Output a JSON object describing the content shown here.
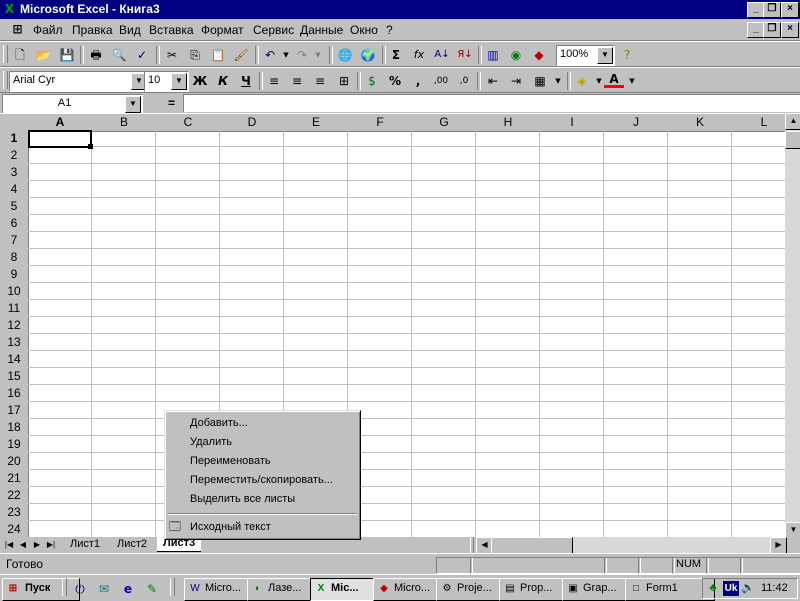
{
  "window": {
    "title": "Microsoft Excel - Книга3"
  },
  "menubar": {
    "items": [
      "Файл",
      "Правка",
      "Вид",
      "Вставка",
      "Формат",
      "Сервис",
      "Данные",
      "Окно",
      "?"
    ]
  },
  "toolbar": {
    "zoom_value": "100%",
    "font_name": "Arial Cyr",
    "font_size": "10",
    "bold_label": "Ж",
    "italic_label": "К",
    "underline_label": "Ч",
    "sum_label": "Σ",
    "fx_label": "fx",
    "percent_label": "%",
    "comma_label": ",",
    "inc_decimal_label": ",00",
    "dec_decimal_label": ",0",
    "font_color_label": "A"
  },
  "formula_bar": {
    "name_box": "A1",
    "equals": "="
  },
  "grid": {
    "columns": [
      "A",
      "B",
      "C",
      "D",
      "E",
      "F",
      "G",
      "H",
      "I",
      "J",
      "K",
      "L"
    ],
    "rows": [
      "1",
      "2",
      "3",
      "4",
      "5",
      "6",
      "7",
      "8",
      "9",
      "10",
      "11",
      "12",
      "13",
      "14",
      "15",
      "16",
      "17",
      "18",
      "19",
      "20",
      "21",
      "22",
      "23",
      "24"
    ],
    "active_cell": "A1"
  },
  "sheet_tabs": [
    "Лист1",
    "Лист2",
    "Лист3"
  ],
  "active_sheet": "Лист3",
  "context_menu": {
    "items": [
      "Добавить...",
      "Удалить",
      "Переименовать",
      "Переместить/скопировать...",
      "Выделить все листы"
    ],
    "extra": "Исходный текст"
  },
  "status_bar": {
    "status": "Готово",
    "num": "NUM"
  },
  "taskbar": {
    "start_label": "Пуск",
    "tasks": [
      "Micro...",
      "Лазе...",
      "Mic...",
      "Micro...",
      "Proje...",
      "Prop...",
      "Grap...",
      "Form1"
    ],
    "active_task": 2,
    "lang": "Uk",
    "clock": "11:42"
  },
  "colors": {
    "title_bar": "#000080",
    "face": "#c0c0c0",
    "grid_line": "#c0c0c0"
  }
}
